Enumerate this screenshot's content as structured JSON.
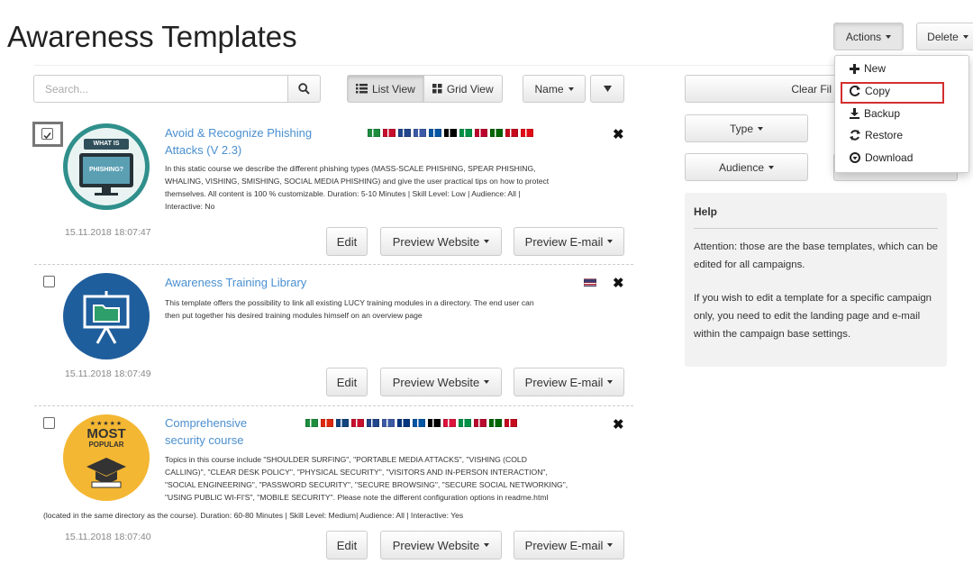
{
  "page": {
    "title": "Awareness Templates"
  },
  "toolbar": {
    "actions_label": "Actions",
    "delete_label": "Delete",
    "search_placeholder": "Search...",
    "list_view_label": "List View",
    "grid_view_label": "Grid View",
    "sort_label": "Name",
    "clear_filter_label": "Clear Fil",
    "type_label": "Type",
    "audience_label": "Audience"
  },
  "actions_menu": {
    "items": [
      {
        "label": "New",
        "icon": "plus-icon"
      },
      {
        "label": "Copy",
        "icon": "copy-refresh-icon"
      },
      {
        "label": "Backup",
        "icon": "download-icon"
      },
      {
        "label": "Restore",
        "icon": "refresh-icon"
      },
      {
        "label": "Download",
        "icon": "circle-arrow-icon"
      }
    ],
    "highlighted": "Copy"
  },
  "help": {
    "heading": "Help",
    "p1": "Attention: those are the base templates, which can be edited for all campaigns.",
    "p2": "If you wish to edit a template for a specific campaign only, you need to edit the landing page and e-mail within the campaign base settings."
  },
  "templates": [
    {
      "title_line1": "Avoid & Recognize Phishing",
      "title_line2": "Attacks (V 2.3)",
      "desc_lines": [
        "In this static course we describe the different phishing types (MASS-SCALE PHISHING, SPEAR PHISHING,",
        "WHALING, VISHING, SMISHING, SOCIAL MEDIA PHISHING) and give the user practical tips on how to protect",
        "themselves. All content is 100 % customizable. Duration: 5-10 Minutes | Skill Level: Low | Audience: All |",
        "Interactive: No"
      ],
      "date": "15.11.2018 18:07:47",
      "checked": true,
      "avatar_text_top": "WHAT IS",
      "avatar_text_screen": "PHISHING?"
    },
    {
      "title_line1": "Awareness Training Library",
      "desc_lines": [
        "This template offers the possibility to link all existing LUCY training modules in a directory. The end user can",
        "then put together his desired training modules himself on an overview page"
      ],
      "date": "15.11.2018 18:07:49",
      "checked": false
    },
    {
      "title_line1": "Comprehensive",
      "title_line2": "security course",
      "desc_lines": [
        "Topics in this course include \"SHOULDER SURFING\", \"PORTABLE MEDIA ATTACKS\", \"VISHING (COLD",
        "CALLING)\", \"CLEAR DESK POLICY\", \"PHYSICAL SECURITY\", \"VISITORS AND IN-PERSON INTERACTION\",",
        "\"SOCIAL ENGINEERING\", \"PASSWORD SECURITY\", \"SECURE BROWSING\", \"SECURE SOCIAL NETWORKING\",",
        "\"USING PUBLIC WI-FI'S\", \"MOBILE SECURITY\". Please note the different configuration options in readme.html",
        "(located in the same directory as the course). Duration: 60-80 Minutes | Skill Level: Medium| Audience: All | Interactive: Yes"
      ],
      "date": "15.11.2018 18:07:40",
      "checked": false,
      "badge_stars": "★★★★★",
      "badge_text1": "MOST",
      "badge_text2": "POPULAR"
    }
  ],
  "card_buttons": {
    "edit": "Edit",
    "preview_website": "Preview Website",
    "preview_email": "Preview E-mail"
  },
  "flags_row1": [
    "#1e8e3e",
    "#c8102e",
    "#21468b",
    "#3c5aa6",
    "#0055a4",
    "#000000",
    "#009246",
    "#bc002d",
    "#006600",
    "#c60b1e",
    "#e30a17"
  ],
  "flags_row3": [
    "#1e8e3e",
    "#de2910",
    "#11457e",
    "#c8102e",
    "#21468b",
    "#3c5aa6",
    "#003580",
    "#0055a4",
    "#000000",
    "#dc143c",
    "#009246",
    "#ba0c2f",
    "#006600",
    "#c60b1e"
  ]
}
